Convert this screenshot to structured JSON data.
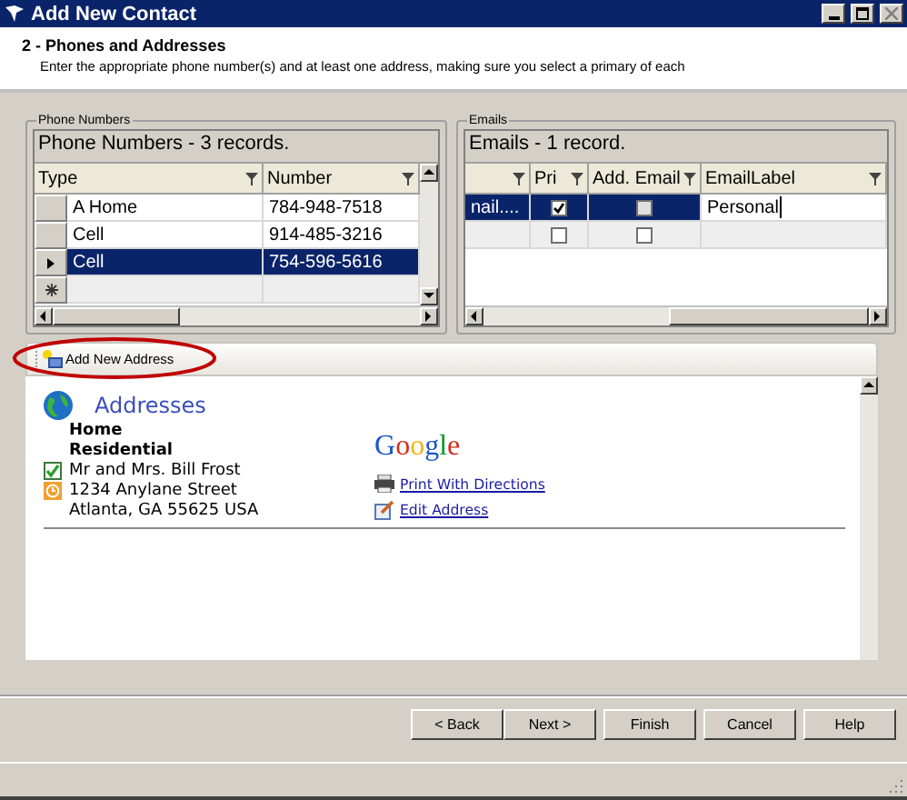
{
  "window": {
    "title": "Add New Contact"
  },
  "header": {
    "step": "2 - Phones and Addresses",
    "description": "Enter the appropriate phone number(s) and at least one address, making sure you select a primary of each"
  },
  "phone_numbers": {
    "group_label": "Phone Numbers",
    "caption": "Phone Numbers - 3 records.",
    "columns": [
      "Type",
      "Number"
    ],
    "rows": [
      {
        "type": "A Home",
        "number": "784-948-7518",
        "selected": false
      },
      {
        "type": "Cell",
        "number": "914-485-3216",
        "selected": false
      },
      {
        "type": "Cell",
        "number": "754-596-5616",
        "selected": true
      }
    ]
  },
  "emails": {
    "group_label": "Emails",
    "caption": "Emails - 1 record.",
    "columns": [
      "",
      "Pri",
      "Add. Email",
      "EmailLabel"
    ],
    "rows": [
      {
        "kind": "record",
        "email": "nail....",
        "primary": true,
        "additional": false,
        "label": "Personal",
        "selected": true
      },
      {
        "kind": "new",
        "primary": false,
        "additional": false,
        "selected": false
      }
    ]
  },
  "addresses": {
    "toolbar_button": "Add New Address",
    "title": "Addresses",
    "logo": "Google",
    "address": {
      "name": "Home",
      "type": "Residential",
      "recipient": "Mr and Mrs. Bill Frost",
      "street": "1234 Anylane Street",
      "city": "Atlanta, GA 55625 USA",
      "primary": true
    },
    "links": [
      {
        "kind": "print",
        "label": "Print With Directions"
      },
      {
        "kind": "edit",
        "label": "Edit Address"
      }
    ]
  },
  "buttons": [
    "< Back",
    "Next >",
    "Finish",
    "Cancel",
    "Help"
  ]
}
